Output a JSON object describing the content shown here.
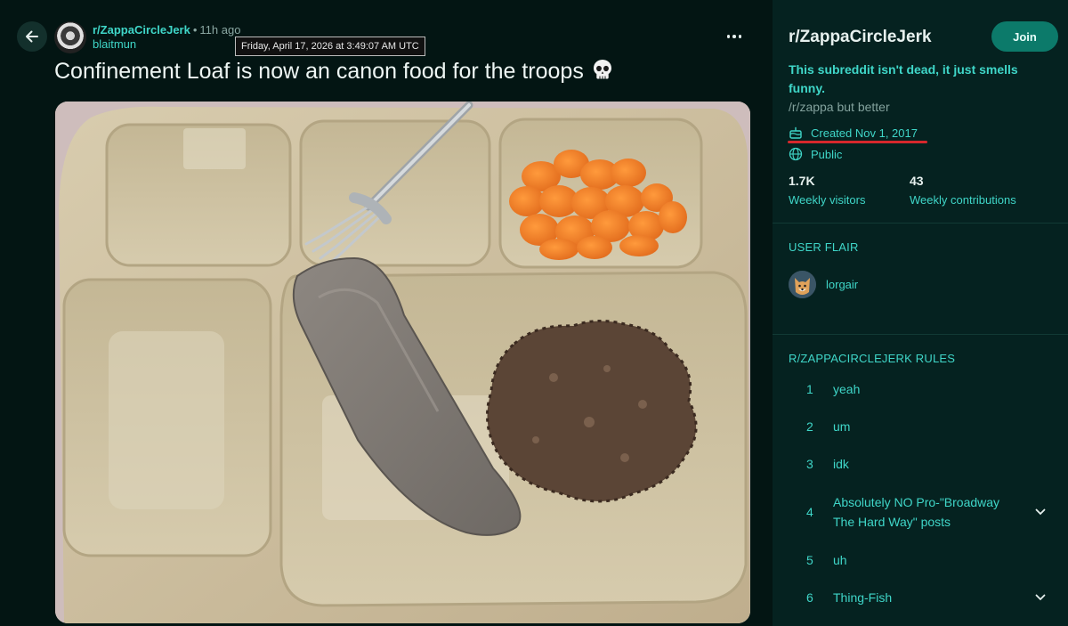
{
  "post": {
    "subreddit": "r/ZappaCircleJerk",
    "separator": "•",
    "time_ago": "11h ago",
    "author": "blaitmun",
    "timestamp_tooltip": "Friday, April 17, 2026 at 3:49:07 AM UTC",
    "title": "Confinement Loaf is now an canon food for the troops",
    "title_emoji": "skull-icon",
    "image_description_icon": "post-image"
  },
  "sidebar": {
    "name": "r/ZappaCircleJerk",
    "join_label": "Join",
    "tagline": "This subreddit isn't dead, it just smells funny.",
    "description": "/r/zappa but better",
    "created": "Created Nov 1, 2017",
    "visibility": "Public",
    "stats": [
      {
        "value": "1.7K",
        "label": "Weekly visitors"
      },
      {
        "value": "43",
        "label": "Weekly contributions"
      }
    ],
    "user_flair_heading": "USER FLAIR",
    "user_flair_name": "lorgair",
    "rules_heading": "R/ZAPPACIRCLEJERK RULES",
    "rules": [
      {
        "num": "1",
        "text": "yeah"
      },
      {
        "num": "2",
        "text": "um"
      },
      {
        "num": "3",
        "text": "idk"
      },
      {
        "num": "4",
        "text": "Absolutely NO Pro-\"Broadway The Hard Way\" posts"
      },
      {
        "num": "5",
        "text": "uh"
      },
      {
        "num": "6",
        "text": "Thing-Fish"
      }
    ]
  },
  "colors": {
    "background": "#031513",
    "sidebar_background": "#052220",
    "accent": "#3fd6c8",
    "join_button": "#0c7a6a",
    "annotation_underline": "#d6282c"
  }
}
